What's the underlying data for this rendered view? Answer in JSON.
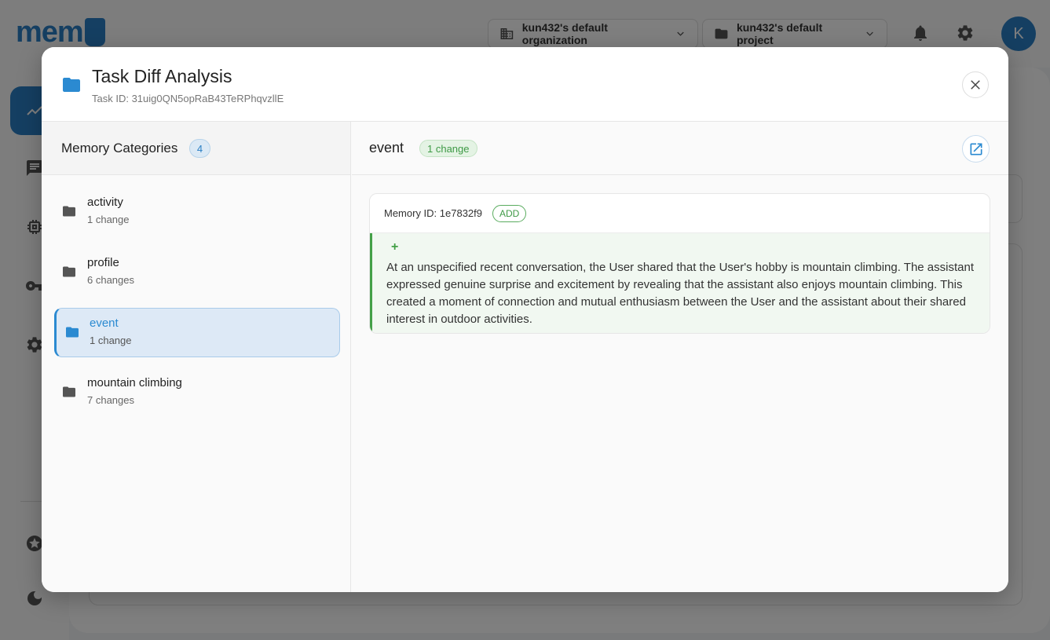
{
  "header": {
    "org_label": "kun432's default organization",
    "project_label": "kun432's default project",
    "avatar_initial": "K"
  },
  "modal": {
    "title": "Task Diff Analysis",
    "task_id": "Task ID: 31uig0QN5opRaB43TeRPhqvzllE"
  },
  "categories": {
    "title": "Memory Categories",
    "count": "4",
    "items": [
      {
        "name": "activity",
        "changes": "1 change"
      },
      {
        "name": "profile",
        "changes": "6 changes"
      },
      {
        "name": "event",
        "changes": "1 change"
      },
      {
        "name": "mountain climbing",
        "changes": "7 changes"
      }
    ],
    "selected_index": 2
  },
  "detail": {
    "title": "event",
    "change_badge": "1 change",
    "memory": {
      "id_label": "Memory ID: 1e7832f9",
      "action": "ADD",
      "diff_marker": "+",
      "text": "At an unspecified recent conversation, the User shared that the User's hobby is mountain climbing. The assistant expressed genuine surprise and excitement by revealing that the assistant also enjoys mountain climbing. This created a moment of connection and mutual enthusiasm between the User and the assistant about their shared interest in outdoor activities."
    }
  },
  "colors": {
    "accent": "#2b7fc4",
    "success": "#43a047",
    "overlay": "rgba(0,0,0,0.5)"
  },
  "icons": {
    "header": [
      "building-icon",
      "folder-icon",
      "bell-icon",
      "gear-icon"
    ],
    "sidebar": [
      "analytics-icon",
      "chat-icon",
      "chip-icon",
      "key-icon",
      "settings-icon",
      "star-icon",
      "moon-icon"
    ],
    "modal": [
      "folder-icon",
      "close-icon",
      "open-external-icon"
    ]
  }
}
